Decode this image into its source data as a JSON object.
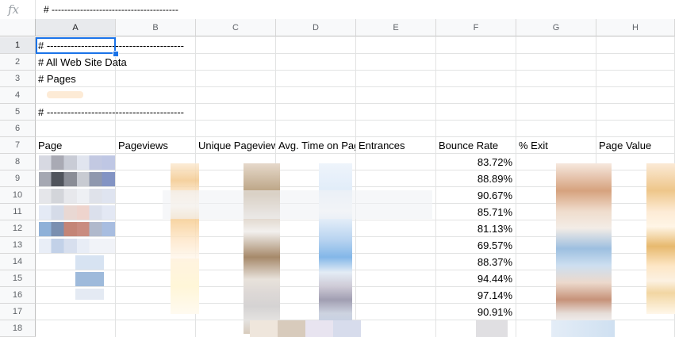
{
  "formula_bar": {
    "fx": "fx",
    "value": "# ----------------------------------------"
  },
  "columns": [
    "A",
    "B",
    "C",
    "D",
    "E",
    "F",
    "G",
    "H"
  ],
  "rows": [
    "1",
    "2",
    "3",
    "4",
    "5",
    "6",
    "7",
    "8",
    "9",
    "10",
    "11",
    "12",
    "13",
    "14",
    "15",
    "16",
    "17",
    "18"
  ],
  "cells": {
    "a1": "# ----------------------------------------",
    "a2": "# All Web Site Data",
    "a3": "# Pages",
    "a5": "# ----------------------------------------"
  },
  "headers": {
    "page": "Page",
    "pageviews": "Pageviews",
    "unique_pageviews": "Unique Pageviews",
    "avg_time": "Avg. Time on Page",
    "entrances": "Entrances",
    "bounce_rate": "Bounce Rate",
    "exit": "% Exit",
    "page_value": "Page Value"
  },
  "bounce_rates": [
    "83.72%",
    "88.89%",
    "90.67%",
    "85.71%",
    "81.13%",
    "69.57%",
    "88.37%",
    "94.44%",
    "97.14%",
    "90.91%"
  ]
}
